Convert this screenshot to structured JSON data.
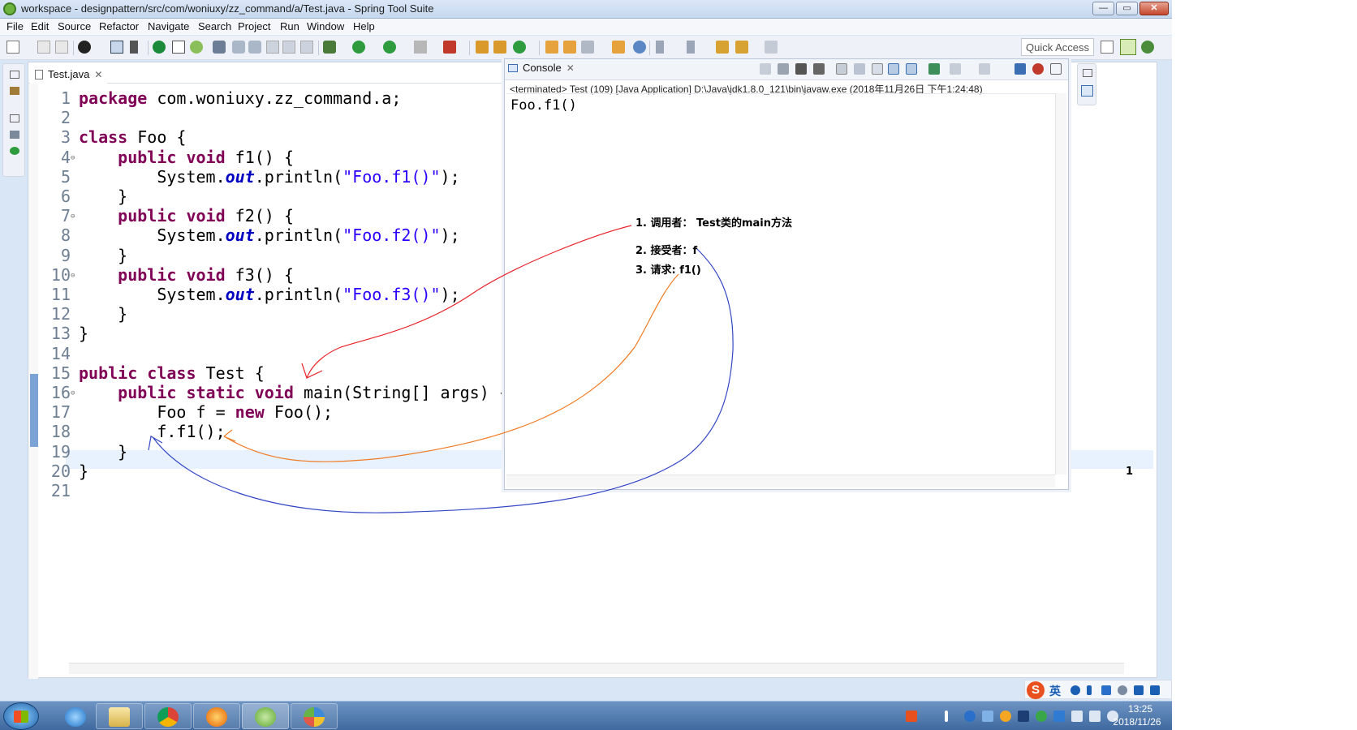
{
  "window": {
    "title": "workspace - designpattern/src/com/woniuxy/zz_command/a/Test.java - Spring Tool Suite",
    "minimize": "—",
    "maximize": "▭",
    "close": "✕"
  },
  "menu": [
    "File",
    "Edit",
    "Source",
    "Refactor",
    "Navigate",
    "Search",
    "Project",
    "Run",
    "Window",
    "Help"
  ],
  "toolbar": {
    "quick_access": "Quick Access"
  },
  "editor": {
    "tab_label": "Test.java",
    "tab_close": "✕",
    "lines": [
      {
        "n": "1",
        "code": "package com.woniuxy.zz_command.a;"
      },
      {
        "n": "2",
        "code": ""
      },
      {
        "n": "3",
        "code": "class Foo {"
      },
      {
        "n": "4",
        "code": "    public void f1() {"
      },
      {
        "n": "5",
        "code": "        System.out.println(\"Foo.f1()\");"
      },
      {
        "n": "6",
        "code": "    }"
      },
      {
        "n": "7",
        "code": "    public void f2() {"
      },
      {
        "n": "8",
        "code": "        System.out.println(\"Foo.f2()\");"
      },
      {
        "n": "9",
        "code": "    }"
      },
      {
        "n": "10",
        "code": "    public void f3() {"
      },
      {
        "n": "11",
        "code": "        System.out.println(\"Foo.f3()\");"
      },
      {
        "n": "12",
        "code": "    }"
      },
      {
        "n": "13",
        "code": "}"
      },
      {
        "n": "14",
        "code": ""
      },
      {
        "n": "15",
        "code": "public class Test {"
      },
      {
        "n": "16",
        "code": "    public static void main(String[] args) {"
      },
      {
        "n": "17",
        "code": "        Foo f = new Foo();"
      },
      {
        "n": "18",
        "code": "        f.f1();"
      },
      {
        "n": "19",
        "code": "    }"
      },
      {
        "n": "20",
        "code": "}"
      },
      {
        "n": "21",
        "code": ""
      }
    ],
    "current_line": 18
  },
  "console": {
    "tab_label": "Console",
    "tab_close": "✕",
    "status": "<terminated> Test (109) [Java Application] D:\\Java\\jdk1.8.0_121\\bin\\javaw.exe (2018年11月26日 下午1:24:48)",
    "output": "Foo.f1()"
  },
  "annotations": {
    "caller": "1. 调用者： Test类的main方法",
    "receiver": "2. 接受者：f",
    "request": "3. 请求:  f1()",
    "corner_number": "1",
    "colors": {
      "caller_arrow": "#e8242b",
      "request_arrow": "#f07a22",
      "receiver_arrow": "#3347c6"
    }
  },
  "ime": {
    "logo": "S",
    "lang": "英"
  },
  "taskbar": {
    "apps": [
      "file-manager-icon",
      "ie-icon",
      "chrome-icon",
      "firefox-icon",
      "spring-tool-suite-icon",
      "paint-icon"
    ],
    "time": "13:25",
    "date": "2018/11/26"
  }
}
